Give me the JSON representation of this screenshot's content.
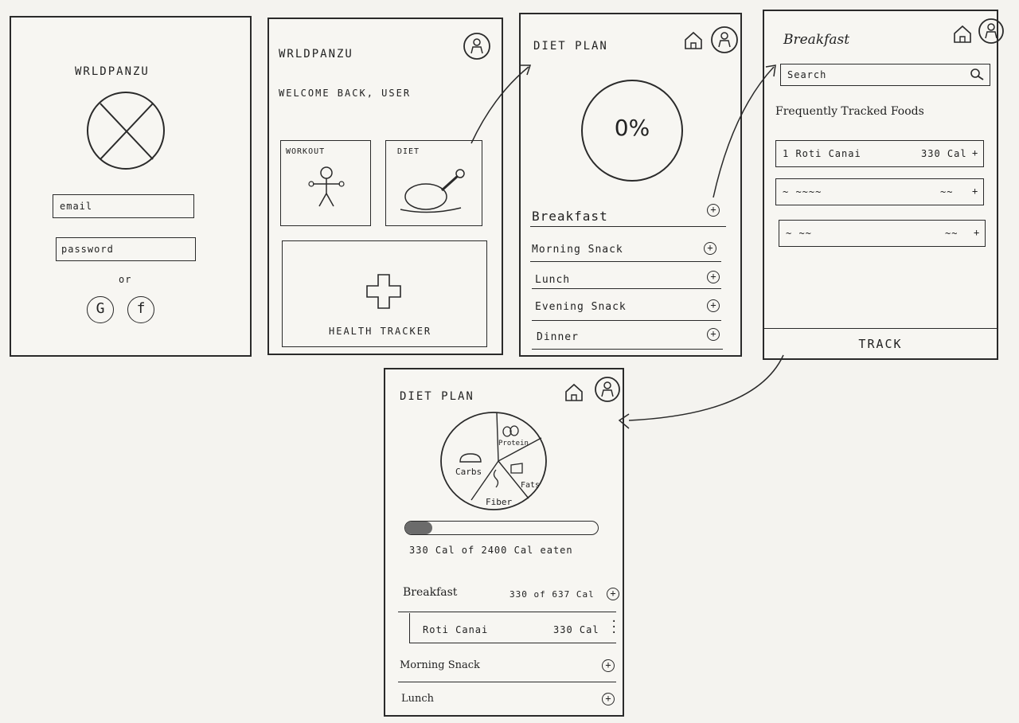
{
  "login": {
    "app_name": "WRLDPANZU",
    "email_placeholder": "email",
    "password_placeholder": "password",
    "or_label": "or",
    "google_label": "G",
    "facebook_label": "f"
  },
  "home": {
    "app_name": "WRLDPANZU",
    "welcome": "WELCOME BACK, USER",
    "workout_label": "WORKOUT",
    "diet_label": "DIET",
    "health_label": "HEALTH TRACKER"
  },
  "diet_plan": {
    "title": "DIET PLAN",
    "progress_text": "0%",
    "meals": [
      {
        "label": "Breakfast"
      },
      {
        "label": "Morning Snack"
      },
      {
        "label": "Lunch"
      },
      {
        "label": "Evening Snack"
      },
      {
        "label": "Dinner"
      }
    ]
  },
  "breakfast": {
    "title": "Breakfast",
    "search_placeholder": "Search",
    "section_title": "Frequently Tracked Foods",
    "foods": [
      {
        "name": "1 Roti Canai",
        "cal": "330 Cal",
        "add": "+"
      },
      {
        "name": "~ ~~~~",
        "cal": "~~",
        "add": "+"
      },
      {
        "name": "~ ~~",
        "cal": "~~",
        "add": "+"
      }
    ],
    "track_label": "TRACK"
  },
  "diet_detail": {
    "title": "DIET PLAN",
    "pie_labels": {
      "protein": "Protein",
      "carbs": "Carbs",
      "fats": "Fats",
      "fiber": "Fiber"
    },
    "calorie_progress": 0.14,
    "calorie_text": "330 Cal of 2400 Cal eaten",
    "breakfast_label": "Breakfast",
    "breakfast_cal": "330 of 637 Cal",
    "item_name": "Roti Canai",
    "item_cal": "330 Cal",
    "morning_snack": "Morning Snack",
    "lunch": "Lunch"
  }
}
